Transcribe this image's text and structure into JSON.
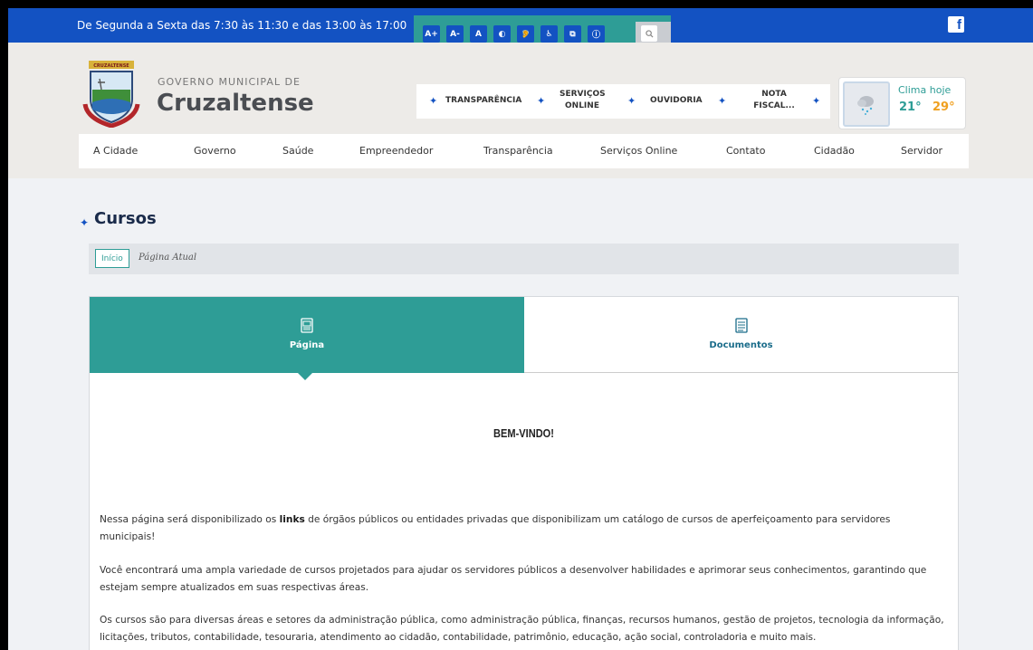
{
  "topbar": {
    "hours": "De Segunda a Sexta das 7:30 às 11:30 e das 13:00 às 17:00",
    "a11y_buttons": [
      {
        "icon": "font-increase-icon",
        "label": "A+"
      },
      {
        "icon": "font-decrease-icon",
        "label": "A-"
      },
      {
        "icon": "font-reset-icon",
        "label": "A"
      },
      {
        "icon": "contrast-icon",
        "label": "◐"
      },
      {
        "icon": "hearing-icon",
        "label": "🦻"
      },
      {
        "icon": "wheelchair-icon",
        "label": "♿"
      },
      {
        "icon": "sitemap-icon",
        "label": "⧉"
      },
      {
        "icon": "info-icon",
        "label": "ⓘ"
      }
    ],
    "search_icon": "search-icon",
    "facebook_label": "f"
  },
  "header": {
    "gov_small": "GOVERNO MUNICIPAL DE",
    "gov_big": "Cruzaltense",
    "crest_banner": "CRUZALTENSE",
    "quicklinks": {
      "transparencia": "TRANSPARÊNCIA",
      "servicos_line1": "SERVIÇOS",
      "servicos_line2": "ONLINE",
      "ouvidoria": "OUVIDORIA",
      "nota_line1": "NOTA",
      "nota_line2": "FISCAL..."
    },
    "weather": {
      "label": "Clima hoje",
      "min": "21°",
      "max": "29°",
      "icon": "rain-cloud-icon"
    }
  },
  "nav": [
    "A Cidade",
    "Governo",
    "Saúde",
    "Empreendedor",
    "Transparência",
    "Serviços Online",
    "Contato",
    "Cidadão",
    "Servidor"
  ],
  "main": {
    "title": "Cursos",
    "breadcrumb_home": "Início",
    "breadcrumb_current": "Página Atual",
    "tab_page": "Página",
    "tab_docs": "Documentos",
    "welcome": "BEM-VINDO!",
    "p1_before": "Nessa página será disponibilizado os ",
    "p1_bold": "links",
    "p1_after": " de órgãos públicos ou entidades privadas que disponibilizam um catálogo de cursos de aperfeiçoamento para servidores municipais!",
    "p2": "Você encontrará uma ampla variedade de cursos projetados para ajudar os servidores públicos a desenvolver habilidades e aprimorar seus conhecimentos, garantindo que estejam sempre atualizados em suas respectivas áreas.",
    "p3": "Os cursos são para diversas áreas e setores da administração pública, como administração pública, finanças, recursos humanos, gestão de projetos, tecnologia da informação, licitações, tributos, contabilidade, tesouraria, atendimento ao cidadão, contabilidade, patrimônio, educação, ação social, controladoria  e muito mais."
  },
  "colors": {
    "primary_blue": "#1352c2",
    "teal": "#2e9d96",
    "orange": "#f0a020"
  }
}
